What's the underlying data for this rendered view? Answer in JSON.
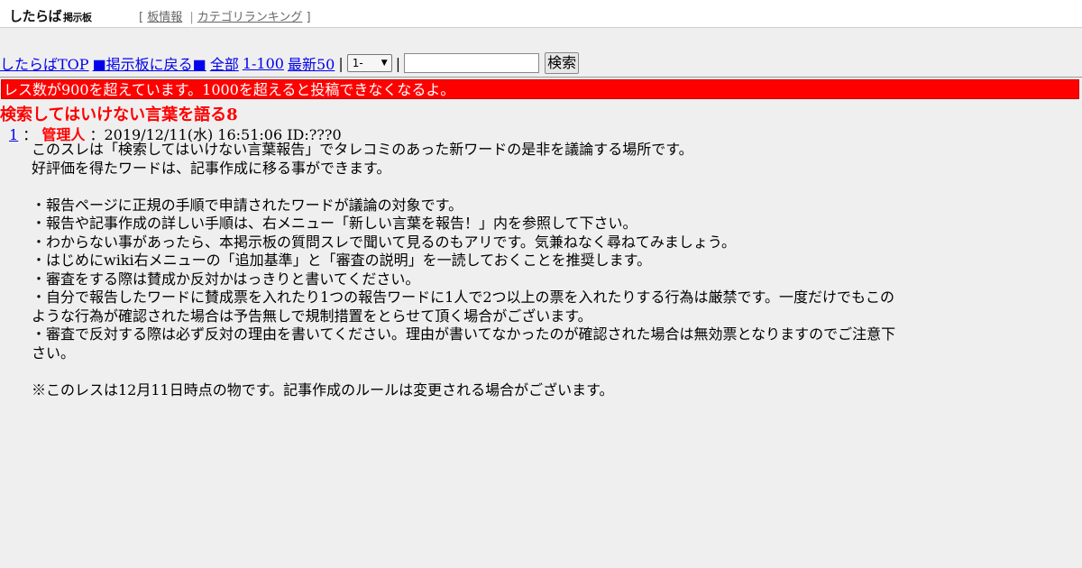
{
  "header": {
    "logo_main": "したらば",
    "logo_sub": "掲示板",
    "bracket_open": "[",
    "bracket_close": "]",
    "links": [
      "板情報",
      "カテゴリランキング"
    ],
    "separator": "|"
  },
  "nav": {
    "links": [
      "したらばTOP",
      "■掲示板に戻る■",
      "全部",
      "1-100",
      "最新50"
    ],
    "separator": "|",
    "select_value": "1-",
    "search_input_value": "",
    "search_button_label": "検索"
  },
  "warning": {
    "text": "レス数が900を超えています。1000を超えると投稿できなくなるよ。",
    "color": "#ff0000"
  },
  "thread": {
    "title": "検索してはいけない言葉を語る8"
  },
  "post": {
    "number": "1",
    "colon": "：",
    "name": "管理人",
    "meta": "：2019/12/11(水) 16:51:06 ID:???0",
    "lines": [
      "このスレは「検索してはいけない言葉報告」でタレコミのあった新ワードの是非を議論する場所です。",
      "好評価を得たワードは、記事作成に移る事ができます。",
      "",
      "・報告ページに正規の手順で申請されたワードが議論の対象です。",
      "・報告や記事作成の詳しい手順は、右メニュー「新しい言葉を報告！」内を参照して下さい。",
      "・わからない事があったら、本掲示板の質問スレで聞いて見るのもアリです。気兼ねなく尋ねてみましょう。",
      "・はじめにwiki右メニューの「追加基準」と「審査の説明」を一読しておくことを推奨します。",
      "・審査をする際は賛成か反対かはっきりと書いてください。",
      "・自分で報告したワードに賛成票を入れたり1つの報告ワードに1人で2つ以上の票を入れたりする行為は厳禁です。一度だけでもこの",
      "ような行為が確認された場合は予告無しで規制措置をとらせて頂く場合がございます。",
      "・審査で反対する際は必ず反対の理由を書いてください。理由が書いてなかったのが確認された場合は無効票となりますのでご注意下",
      "さい。",
      "",
      "※このレスは12月11日時点の物です。記事作成のルールは変更される場合がございます。"
    ]
  }
}
